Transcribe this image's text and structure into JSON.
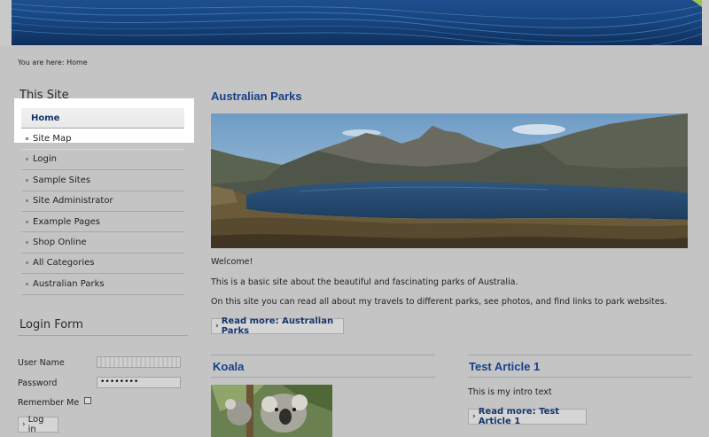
{
  "breadcrumb": "You are here: Home",
  "sidebar": {
    "this_site_title": "This Site",
    "menu": [
      {
        "label": "Home"
      },
      {
        "label": "Site Map"
      },
      {
        "label": "Login"
      },
      {
        "label": "Sample Sites"
      },
      {
        "label": "Site Administrator"
      },
      {
        "label": "Example Pages"
      },
      {
        "label": "Shop Online"
      },
      {
        "label": "All Categories"
      },
      {
        "label": "Australian Parks"
      }
    ],
    "login_title": "Login Form",
    "login": {
      "user_label": "User Name",
      "user_value": "",
      "password_label": "Password",
      "password_value": "••••••••",
      "remember_label": "Remember Me",
      "login_button": "Log in"
    }
  },
  "main": {
    "title": "Australian Parks",
    "welcome": "Welcome!",
    "para1": "This is a basic site about the beautiful and fascinating parks of Australia.",
    "para2": "On this site you can read all about my travels to different parks, see photos, and find links to park websites.",
    "read_more": "Read more: Australian Parks",
    "koala_title": "Koala",
    "test_title": "Test Article 1",
    "test_intro": "This is my intro text",
    "test_read_more": "Read more: Test Article 1"
  },
  "colors": {
    "heading": "#15418a",
    "banner": "#1d4f8e",
    "background": "#c4c4c4"
  }
}
